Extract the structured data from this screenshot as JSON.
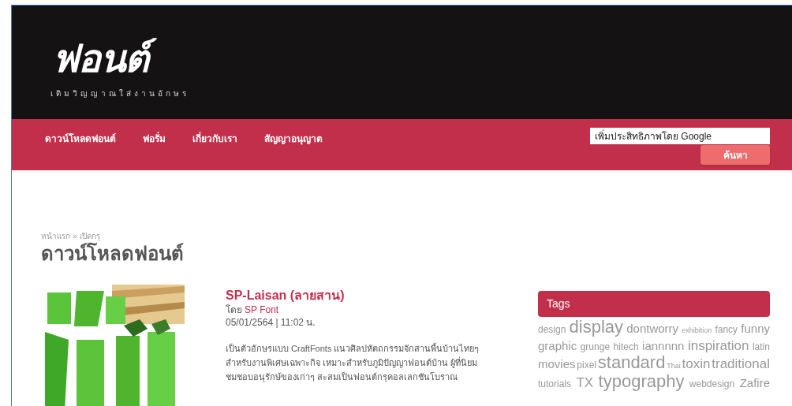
{
  "logo": {
    "wordmark": "ฟอนต์",
    "tagline": "เติมวิญญาณใส่งานอักษร"
  },
  "nav": [
    {
      "label": "ดาวน์โหลดฟอนต์"
    },
    {
      "label": "ฟอรั่ม"
    },
    {
      "label": "เกี่ยวกับเรา"
    },
    {
      "label": "สัญญาอนุญาต"
    }
  ],
  "search": {
    "placeholder": "เพิ่มประสิทธิภาพโดย Google",
    "button": "ค้นหา"
  },
  "breadcrumb": [
    "หน้าแรก",
    "»",
    "เปิดกรุ"
  ],
  "page_title": "ดาวน์โหลดฟอนต์",
  "post": {
    "title": "SP-Laisan (ลายสาน)",
    "by_label": "โดย",
    "author": "SP Font",
    "date": "05/01/2564 | 11:02 น.",
    "description": "เป็นตัวอักษรแบบ CraftFonts แนวศิลปหัตถกรรมจักสานพื้นบ้านไทยๆ สำหรับงานพิเศษเฉพาะกิจ เหมาะสำหรับภูมิปัญญาฟอนต์บ้าน ผู้ที่นิยมชมชอบอนุรักษ์ของเก่าๆ สะสมเป็นฟอนต์กรุคอลเลกชันโบราณ"
  },
  "tags": {
    "title": "Tags",
    "lines": [
      [
        {
          "label": "design",
          "kind": "s"
        },
        {
          "label": "display",
          "kind": "xl"
        },
        {
          "label": "dontworry",
          "kind": "m"
        },
        {
          "label": "exhibition",
          "kind": "xs"
        },
        {
          "label": "fancy",
          "kind": "s"
        },
        {
          "label": "funny",
          "kind": "m"
        }
      ],
      [
        {
          "label": "graphic",
          "kind": "m"
        },
        {
          "label": "grunge",
          "kind": "s"
        },
        {
          "label": "hitech",
          "kind": "s"
        },
        {
          "label": "iannnnn",
          "kind": "m"
        },
        {
          "label": "inspiration",
          "kind": "l"
        },
        {
          "label": "latin",
          "kind": "s"
        }
      ],
      [
        {
          "label": "movies",
          "kind": "m"
        },
        {
          "label": "pixel",
          "kind": "s"
        },
        {
          "label": "standard",
          "kind": "xl"
        },
        {
          "label": "Thai",
          "kind": "xs"
        },
        {
          "label": "toxin",
          "kind": "l"
        },
        {
          "label": "traditional",
          "kind": "l"
        }
      ],
      [
        {
          "label": "tutorials",
          "kind": "s"
        },
        {
          "label": "TX",
          "kind": "l"
        },
        {
          "label": "typography",
          "kind": "xl"
        },
        {
          "label": "webdesign",
          "kind": "s"
        },
        {
          "label": "Zafire",
          "kind": "m"
        }
      ]
    ]
  }
}
